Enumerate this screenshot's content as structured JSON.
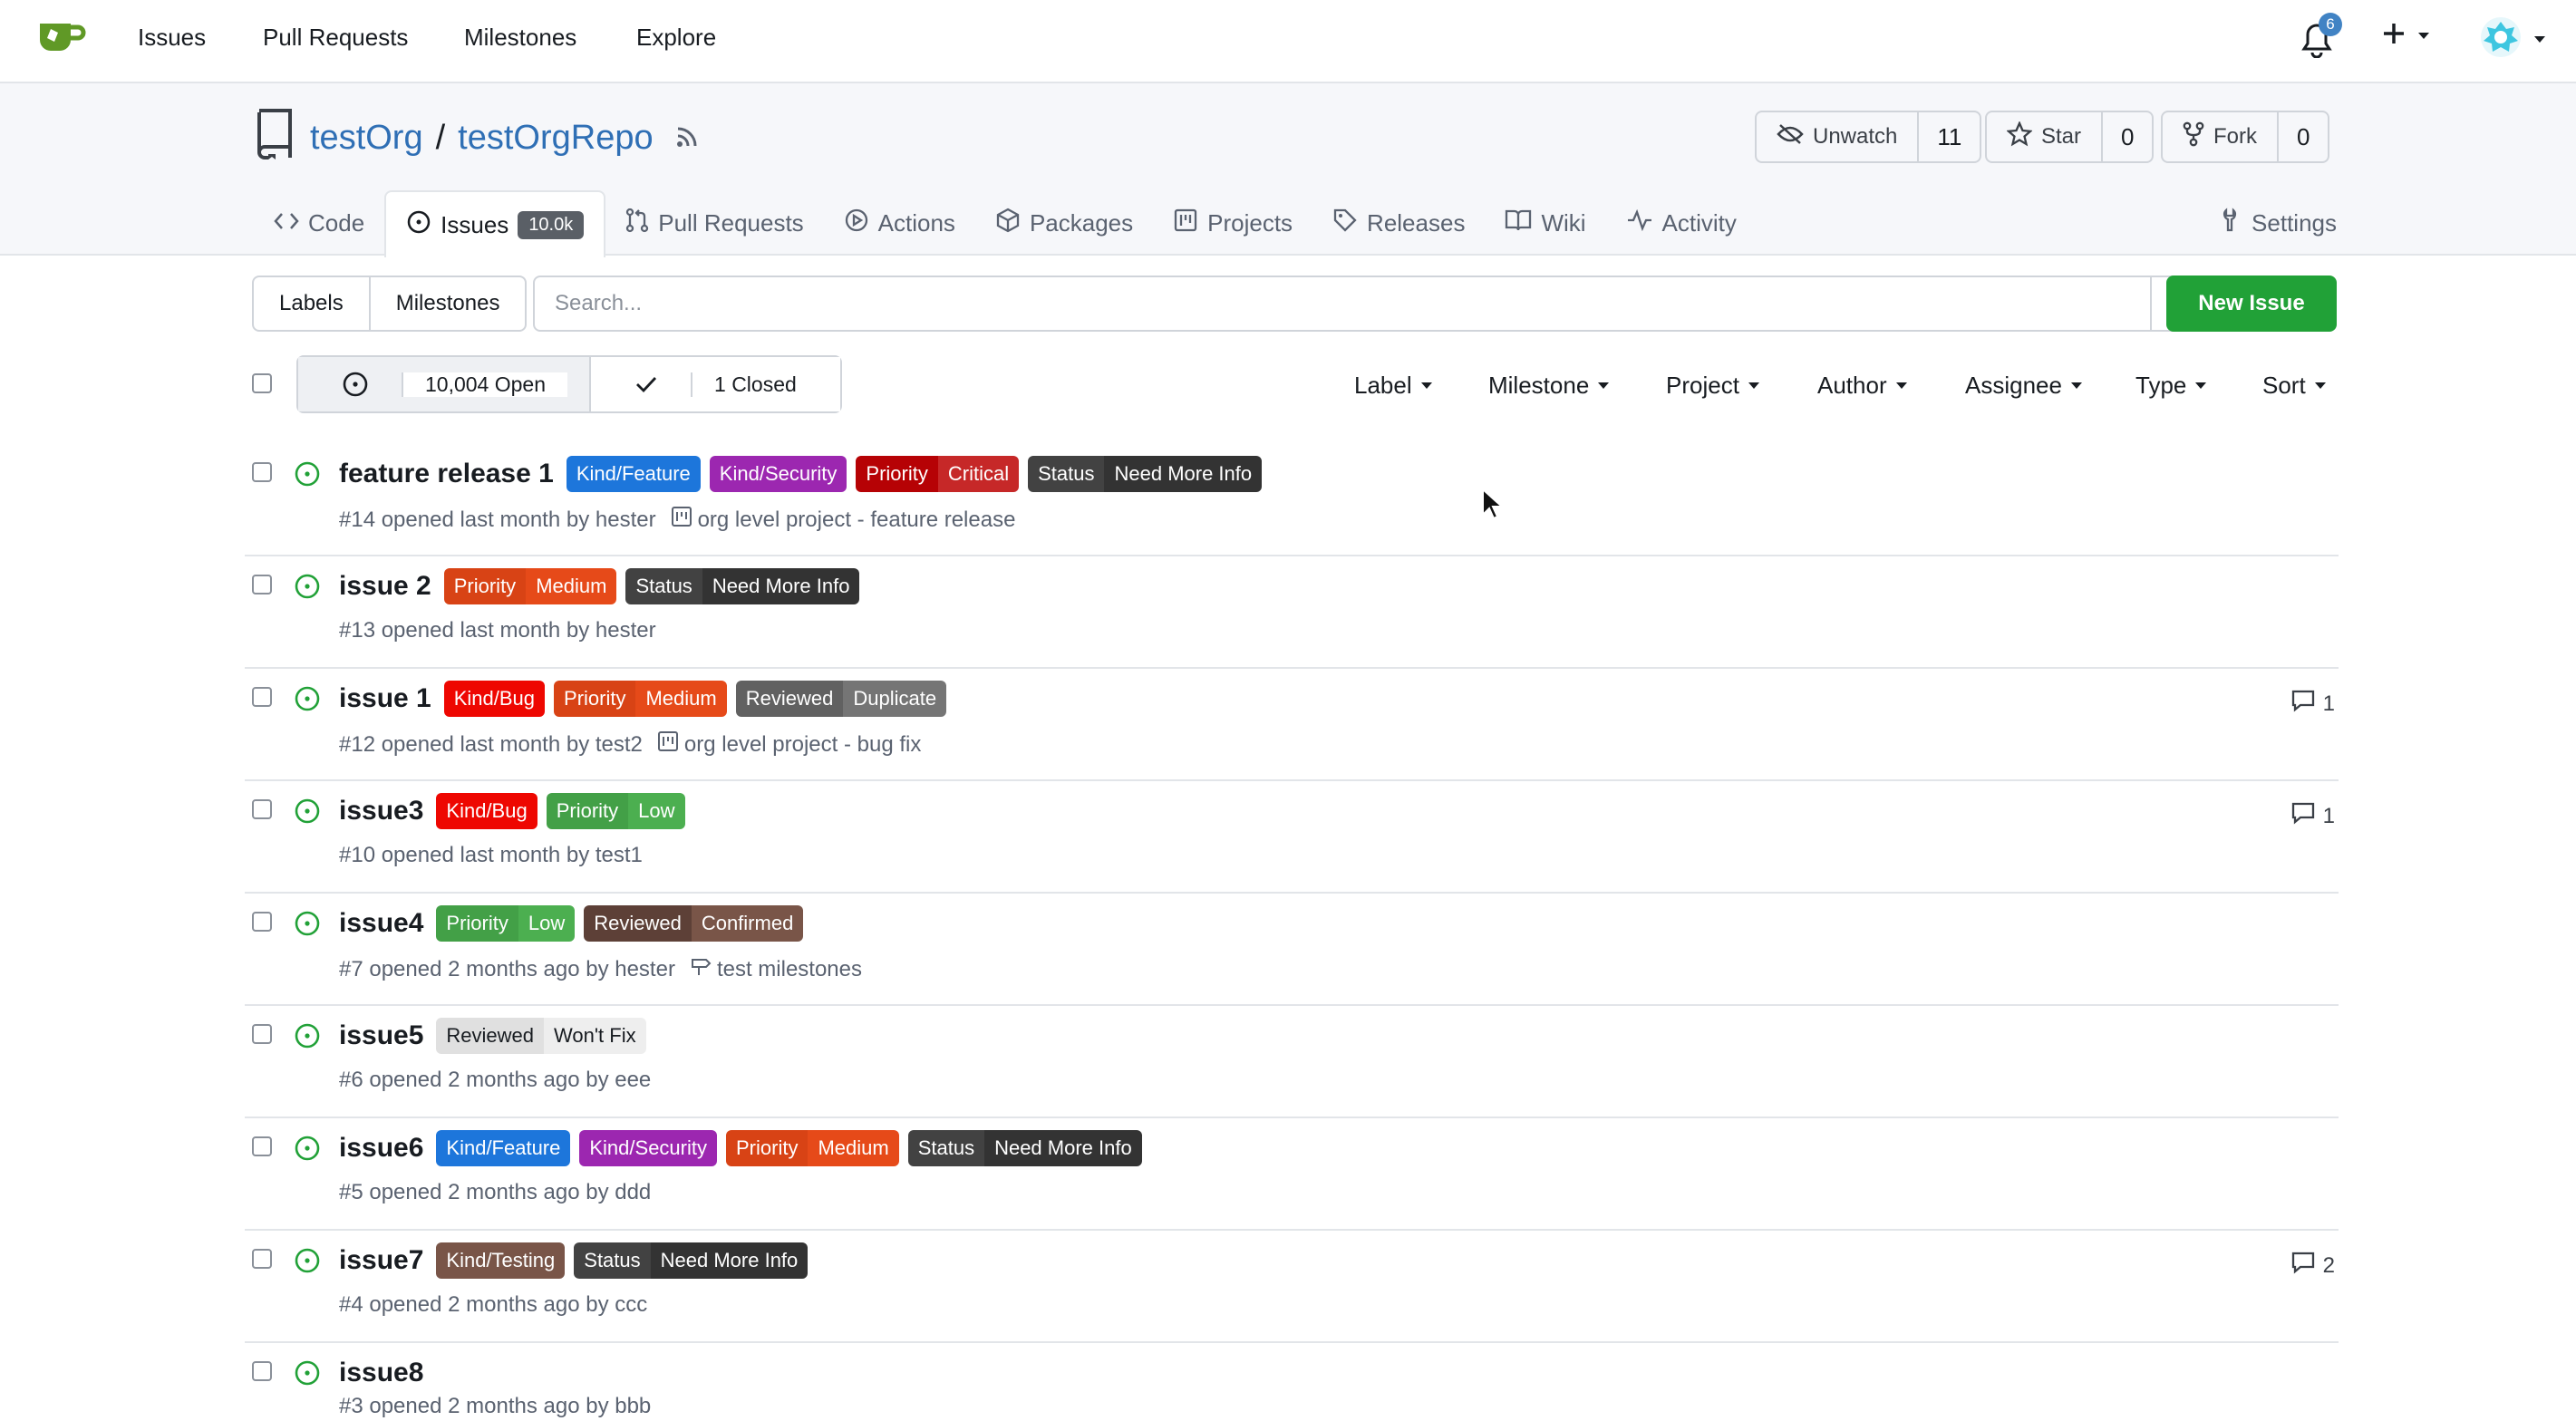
{
  "nav": {
    "items": [
      "Issues",
      "Pull Requests",
      "Milestones",
      "Explore"
    ],
    "notification_count": "6"
  },
  "repo": {
    "owner": "testOrg",
    "name": "testOrgRepo",
    "unwatch_label": "Unwatch",
    "watch_count": "11",
    "star_label": "Star",
    "star_count": "0",
    "fork_label": "Fork",
    "fork_count": "0"
  },
  "tabs": {
    "code": "Code",
    "issues": "Issues",
    "issues_badge": "10.0k",
    "pulls": "Pull Requests",
    "actions": "Actions",
    "packages": "Packages",
    "projects": "Projects",
    "releases": "Releases",
    "wiki": "Wiki",
    "activity": "Activity",
    "settings": "Settings"
  },
  "toolbar": {
    "labels": "Labels",
    "milestones": "Milestones",
    "search_placeholder": "Search...",
    "new_issue": "New Issue"
  },
  "filters": {
    "open": "10,004 Open",
    "closed": "1 Closed",
    "label": "Label",
    "milestone": "Milestone",
    "project": "Project",
    "author": "Author",
    "assignee": "Assignee",
    "type": "Type",
    "sort": "Sort"
  },
  "issues": [
    {
      "title": "feature release 1",
      "meta": "#14 opened last month by hester",
      "extra": "org level project - feature release",
      "extra_type": "project",
      "comments": ""
    },
    {
      "title": "issue 2",
      "meta": "#13 opened last month by hester",
      "extra": "",
      "extra_type": "",
      "comments": ""
    },
    {
      "title": "issue 1",
      "meta": "#12 opened last month by test2",
      "extra": "org level project - bug fix",
      "extra_type": "project",
      "comments": "1"
    },
    {
      "title": "issue3",
      "meta": "#10 opened last month by test1",
      "extra": "",
      "extra_type": "",
      "comments": "1"
    },
    {
      "title": "issue4",
      "meta": "#7 opened 2 months ago by hester",
      "extra": "test milestones",
      "extra_type": "milestone",
      "comments": ""
    },
    {
      "title": "issue5",
      "meta": "#6 opened 2 months ago by eee",
      "extra": "",
      "extra_type": "",
      "comments": ""
    },
    {
      "title": "issue6",
      "meta": "#5 opened 2 months ago by ddd",
      "extra": "",
      "extra_type": "",
      "comments": ""
    },
    {
      "title": "issue7",
      "meta": "#4 opened 2 months ago by ccc",
      "extra": "",
      "extra_type": "",
      "comments": "2"
    },
    {
      "title": "issue8",
      "meta": "#3 opened 2 months ago by bbb",
      "extra": "",
      "extra_type": "",
      "comments": ""
    }
  ],
  "labels": {
    "kind_feature": "Kind/Feature",
    "kind_security": "Kind/Security",
    "kind_bug": "Kind/Bug",
    "kind_testing": "Kind/Testing",
    "priority": "Priority",
    "critical": "Critical",
    "medium": "Medium",
    "low": "Low",
    "status": "Status",
    "need_more_info": "Need More Info",
    "reviewed": "Reviewed",
    "duplicate": "Duplicate",
    "confirmed": "Confirmed",
    "wont_fix": "Won't Fix"
  },
  "colors": {
    "accent": "#21a137",
    "link": "#2f6fb5",
    "open_icon": "#21a137",
    "kind_feature": "#1d76db",
    "kind_security": "#9c27b0",
    "kind_bug": "#ee0701",
    "kind_testing": "#795548",
    "priority_critical": "#b60205",
    "priority_medium": "#e64a19",
    "priority_low": "#4caf50",
    "status": "#424242",
    "reviewed_dark": "#616161",
    "reviewed_confirmed": "#795548",
    "reviewed_light": "#eeeeee"
  }
}
